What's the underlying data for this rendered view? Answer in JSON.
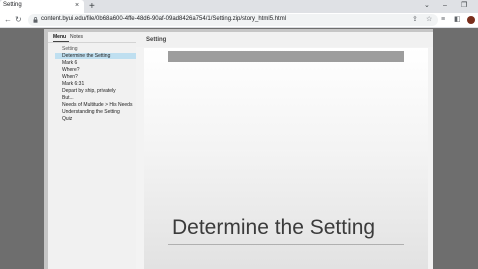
{
  "browser": {
    "tab_title": "Setting",
    "tab_close": "×",
    "new_tab": "+",
    "url": "content.byui.edu/file/0b68a600-4ffe-48d6-90af-09ad8426a754/1/Setting.zip/story_html5.html",
    "controls": {
      "dropdown": "⌄",
      "minimize": "–",
      "restore": "❐"
    },
    "nav": {
      "back": "←",
      "forward": "→",
      "reload": "↻"
    }
  },
  "player": {
    "tabs": [
      {
        "label": "Menu",
        "active": true
      },
      {
        "label": "Notes",
        "active": false
      }
    ],
    "section_label": "Setting",
    "menu_items": [
      {
        "label": "Determine the Setting",
        "selected": true
      },
      {
        "label": "Mark 6"
      },
      {
        "label": "Where?"
      },
      {
        "label": "When?"
      },
      {
        "label": "Mark 6:31"
      },
      {
        "label": "Depart by ship, privately"
      },
      {
        "label": "But..."
      },
      {
        "label": "Needs of Multitude > His Needs"
      },
      {
        "label": "Understanding the Setting"
      },
      {
        "label": "Quiz"
      }
    ],
    "content_title": "Setting",
    "slide_heading": "Determine the Setting"
  },
  "colors": {
    "selected_item": "#bfdff0",
    "player_frame": "#c6c6c6",
    "avatar": "#7a2e1c"
  }
}
